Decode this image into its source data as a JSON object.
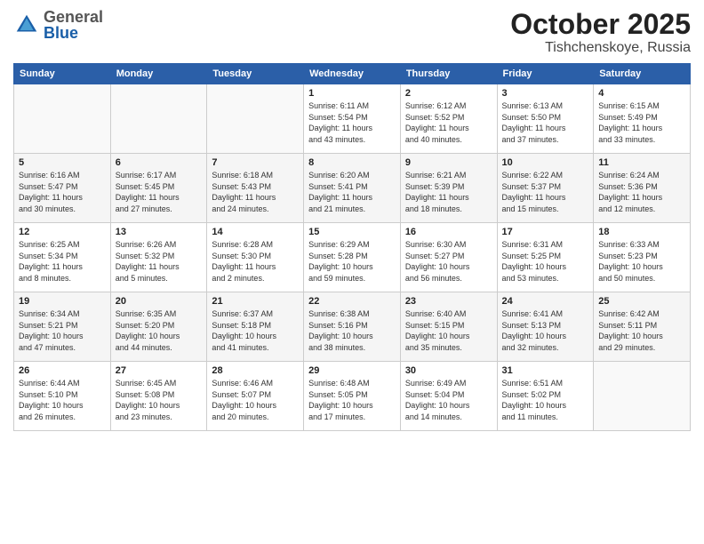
{
  "header": {
    "logo": {
      "general": "General",
      "blue": "Blue"
    },
    "title": "October 2025",
    "location": "Tishchenskoye, Russia"
  },
  "weekdays": [
    "Sunday",
    "Monday",
    "Tuesday",
    "Wednesday",
    "Thursday",
    "Friday",
    "Saturday"
  ],
  "weeks": [
    [
      {
        "day": "",
        "info": ""
      },
      {
        "day": "",
        "info": ""
      },
      {
        "day": "",
        "info": ""
      },
      {
        "day": "1",
        "info": "Sunrise: 6:11 AM\nSunset: 5:54 PM\nDaylight: 11 hours\nand 43 minutes."
      },
      {
        "day": "2",
        "info": "Sunrise: 6:12 AM\nSunset: 5:52 PM\nDaylight: 11 hours\nand 40 minutes."
      },
      {
        "day": "3",
        "info": "Sunrise: 6:13 AM\nSunset: 5:50 PM\nDaylight: 11 hours\nand 37 minutes."
      },
      {
        "day": "4",
        "info": "Sunrise: 6:15 AM\nSunset: 5:49 PM\nDaylight: 11 hours\nand 33 minutes."
      }
    ],
    [
      {
        "day": "5",
        "info": "Sunrise: 6:16 AM\nSunset: 5:47 PM\nDaylight: 11 hours\nand 30 minutes."
      },
      {
        "day": "6",
        "info": "Sunrise: 6:17 AM\nSunset: 5:45 PM\nDaylight: 11 hours\nand 27 minutes."
      },
      {
        "day": "7",
        "info": "Sunrise: 6:18 AM\nSunset: 5:43 PM\nDaylight: 11 hours\nand 24 minutes."
      },
      {
        "day": "8",
        "info": "Sunrise: 6:20 AM\nSunset: 5:41 PM\nDaylight: 11 hours\nand 21 minutes."
      },
      {
        "day": "9",
        "info": "Sunrise: 6:21 AM\nSunset: 5:39 PM\nDaylight: 11 hours\nand 18 minutes."
      },
      {
        "day": "10",
        "info": "Sunrise: 6:22 AM\nSunset: 5:37 PM\nDaylight: 11 hours\nand 15 minutes."
      },
      {
        "day": "11",
        "info": "Sunrise: 6:24 AM\nSunset: 5:36 PM\nDaylight: 11 hours\nand 12 minutes."
      }
    ],
    [
      {
        "day": "12",
        "info": "Sunrise: 6:25 AM\nSunset: 5:34 PM\nDaylight: 11 hours\nand 8 minutes."
      },
      {
        "day": "13",
        "info": "Sunrise: 6:26 AM\nSunset: 5:32 PM\nDaylight: 11 hours\nand 5 minutes."
      },
      {
        "day": "14",
        "info": "Sunrise: 6:28 AM\nSunset: 5:30 PM\nDaylight: 11 hours\nand 2 minutes."
      },
      {
        "day": "15",
        "info": "Sunrise: 6:29 AM\nSunset: 5:28 PM\nDaylight: 10 hours\nand 59 minutes."
      },
      {
        "day": "16",
        "info": "Sunrise: 6:30 AM\nSunset: 5:27 PM\nDaylight: 10 hours\nand 56 minutes."
      },
      {
        "day": "17",
        "info": "Sunrise: 6:31 AM\nSunset: 5:25 PM\nDaylight: 10 hours\nand 53 minutes."
      },
      {
        "day": "18",
        "info": "Sunrise: 6:33 AM\nSunset: 5:23 PM\nDaylight: 10 hours\nand 50 minutes."
      }
    ],
    [
      {
        "day": "19",
        "info": "Sunrise: 6:34 AM\nSunset: 5:21 PM\nDaylight: 10 hours\nand 47 minutes."
      },
      {
        "day": "20",
        "info": "Sunrise: 6:35 AM\nSunset: 5:20 PM\nDaylight: 10 hours\nand 44 minutes."
      },
      {
        "day": "21",
        "info": "Sunrise: 6:37 AM\nSunset: 5:18 PM\nDaylight: 10 hours\nand 41 minutes."
      },
      {
        "day": "22",
        "info": "Sunrise: 6:38 AM\nSunset: 5:16 PM\nDaylight: 10 hours\nand 38 minutes."
      },
      {
        "day": "23",
        "info": "Sunrise: 6:40 AM\nSunset: 5:15 PM\nDaylight: 10 hours\nand 35 minutes."
      },
      {
        "day": "24",
        "info": "Sunrise: 6:41 AM\nSunset: 5:13 PM\nDaylight: 10 hours\nand 32 minutes."
      },
      {
        "day": "25",
        "info": "Sunrise: 6:42 AM\nSunset: 5:11 PM\nDaylight: 10 hours\nand 29 minutes."
      }
    ],
    [
      {
        "day": "26",
        "info": "Sunrise: 6:44 AM\nSunset: 5:10 PM\nDaylight: 10 hours\nand 26 minutes."
      },
      {
        "day": "27",
        "info": "Sunrise: 6:45 AM\nSunset: 5:08 PM\nDaylight: 10 hours\nand 23 minutes."
      },
      {
        "day": "28",
        "info": "Sunrise: 6:46 AM\nSunset: 5:07 PM\nDaylight: 10 hours\nand 20 minutes."
      },
      {
        "day": "29",
        "info": "Sunrise: 6:48 AM\nSunset: 5:05 PM\nDaylight: 10 hours\nand 17 minutes."
      },
      {
        "day": "30",
        "info": "Sunrise: 6:49 AM\nSunset: 5:04 PM\nDaylight: 10 hours\nand 14 minutes."
      },
      {
        "day": "31",
        "info": "Sunrise: 6:51 AM\nSunset: 5:02 PM\nDaylight: 10 hours\nand 11 minutes."
      },
      {
        "day": "",
        "info": ""
      }
    ]
  ]
}
